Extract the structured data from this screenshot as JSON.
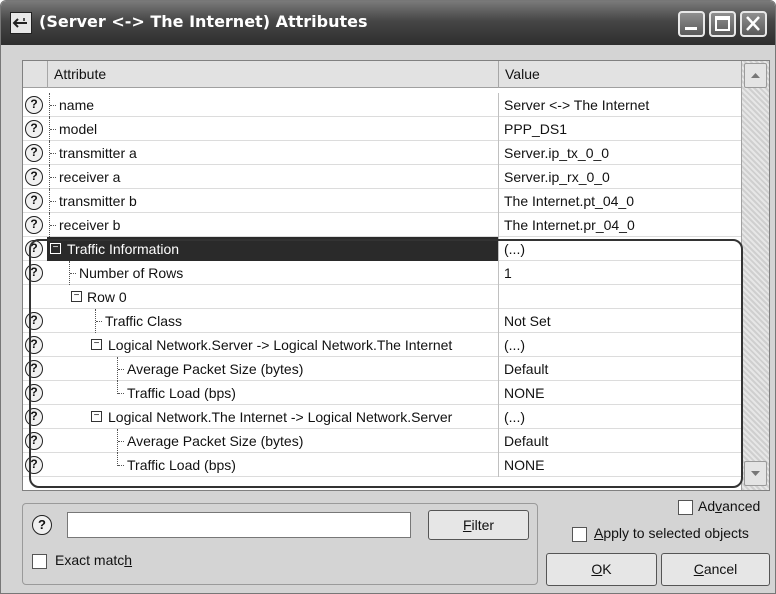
{
  "window": {
    "title": "(Server <-> The Internet) Attributes"
  },
  "grid": {
    "columns": [
      "Attribute",
      "Value"
    ],
    "rows": [
      {
        "label": "name",
        "value": "Server <-> The Internet"
      },
      {
        "label": "model",
        "value": "PPP_DS1"
      },
      {
        "label": "transmitter a",
        "value": "Server.ip_tx_0_0"
      },
      {
        "label": "receiver a",
        "value": "Server.ip_rx_0_0"
      },
      {
        "label": "transmitter b",
        "value": "The Internet.pt_04_0"
      },
      {
        "label": "receiver b",
        "value": "The Internet.pr_04_0"
      },
      {
        "label": "Traffic Information",
        "value": "(...)"
      },
      {
        "label": "Number of Rows",
        "value": "1"
      },
      {
        "label": "Row 0",
        "value": ""
      },
      {
        "label": "Traffic Class",
        "value": "Not Set"
      },
      {
        "label": "Logical Network.Server -> Logical Network.The Internet",
        "value": "(...)"
      },
      {
        "label": "Average Packet Size (bytes)",
        "value": "Default"
      },
      {
        "label": "Traffic Load (bps)",
        "value": "NONE"
      },
      {
        "label": "Logical Network.The Internet -> Logical Network.Server",
        "value": "(...)"
      },
      {
        "label": "Average Packet Size (bytes)",
        "value": "Default"
      },
      {
        "label": "Traffic Load (bps)",
        "value": "NONE"
      }
    ]
  },
  "search": {
    "value": "",
    "filter_label_pre": "",
    "filter_label_ul": "F",
    "filter_label_post": "ilter",
    "exact_match_pre": "Exact matc",
    "exact_match_ul": "h",
    "exact_match_post": ""
  },
  "options": {
    "advanced_pre": "Ad",
    "advanced_ul": "v",
    "advanced_post": "anced",
    "apply_pre": "",
    "apply_ul": "A",
    "apply_post": "pply to selected objects"
  },
  "buttons": {
    "ok_ul": "O",
    "ok_post": "K",
    "cancel_ul": "C",
    "cancel_post": "ancel"
  },
  "icons": {
    "help": "?",
    "expander_minus": "−"
  }
}
